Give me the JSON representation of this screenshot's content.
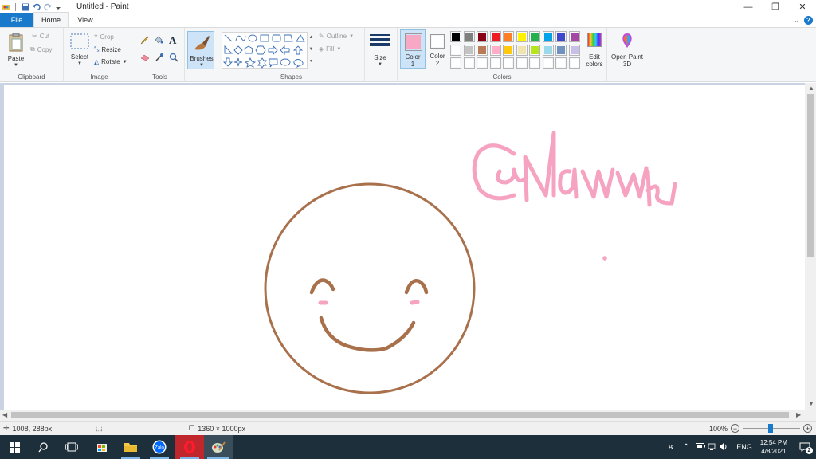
{
  "window": {
    "title": "Untitled - Paint"
  },
  "tabs": {
    "file": "File",
    "home": "Home",
    "view": "View"
  },
  "ribbon": {
    "clipboard": {
      "paste": "Paste",
      "cut": "Cut",
      "copy": "Copy",
      "group": "Clipboard"
    },
    "image": {
      "select": "Select",
      "crop": "Crop",
      "resize": "Resize",
      "rotate": "Rotate",
      "group": "Image"
    },
    "tools": {
      "group": "Tools"
    },
    "brushes": {
      "label": "Brushes"
    },
    "shapes": {
      "outline": "Outline",
      "fill": "Fill",
      "group": "Shapes"
    },
    "size": {
      "label": "Size"
    },
    "colors": {
      "color1": "Color",
      "color1_num": "1",
      "color2": "Color",
      "color2_num": "2",
      "edit": "Edit colors",
      "group": "Colors",
      "color1_value": "#f7a8c4",
      "color2_value": "#ffffff",
      "palette_row1": [
        "#000000",
        "#7f7f7f",
        "#880015",
        "#ed1c24",
        "#ff7f27",
        "#fff200",
        "#22b14c",
        "#00a2e8",
        "#3f48cc",
        "#a349a4"
      ],
      "palette_row2": [
        "#ffffff",
        "#c3c3c3",
        "#b97a57",
        "#ffaec9",
        "#ffc90e",
        "#efe4b0",
        "#b5e61d",
        "#99d9ea",
        "#7092be",
        "#c8bfe7"
      ],
      "palette_row3": [
        "#ffffff",
        "#ffffff",
        "#ffffff",
        "#ffffff",
        "#ffffff",
        "#ffffff",
        "#ffffff",
        "#ffffff",
        "#ffffff",
        "#ffffff"
      ]
    },
    "paint3d": {
      "label": "Open Paint 3D"
    }
  },
  "status": {
    "cursor": "1008, 288px",
    "canvas_size": "1360 × 1000px",
    "zoom": "100%"
  },
  "taskbar": {
    "lang": "ENG",
    "time": "12:54 PM",
    "date": "4/8/2021",
    "notifications": "2"
  },
  "drawing": {
    "stroke_brown": "#a9704c",
    "stroke_pink": "#f5a3c0"
  }
}
